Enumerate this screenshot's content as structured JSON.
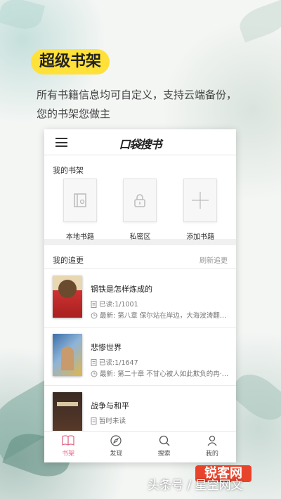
{
  "promo": {
    "title": "超级书架",
    "subtitle_line1": "所有书籍信息均可自定义，支持云端备份，",
    "subtitle_line2": "您的书架您做主"
  },
  "app": {
    "logo_text": "口袋搜书",
    "shelf_section_title": "我的书架",
    "shelf_items": [
      {
        "label": "本地书籍",
        "icon": "local-book-icon"
      },
      {
        "label": "私密区",
        "icon": "lock-icon"
      },
      {
        "label": "添加书籍",
        "icon": "plus-icon"
      }
    ],
    "following_section_title": "我的追更",
    "refresh_label": "刷新追更",
    "books": [
      {
        "title": "钢铁是怎样炼成的",
        "read": "已读:1/1001",
        "latest": "最新: 第八章  保尔站在岸边，大海波涛翻滚..."
      },
      {
        "title": "悲惨世界",
        "read": "已读:1/1647",
        "latest": "最新: 第二十章  不甘心被人如此欺负的冉·阿让..."
      },
      {
        "title": "战争与和平",
        "read": "暂时未读",
        "latest": ""
      }
    ],
    "tabs": [
      {
        "label": "书架",
        "icon": "book-icon",
        "active": true
      },
      {
        "label": "发现",
        "icon": "compass-icon",
        "active": false
      },
      {
        "label": "搜索",
        "icon": "search-icon",
        "active": false
      },
      {
        "label": "我的",
        "icon": "user-icon",
        "active": false
      }
    ]
  },
  "watermark": {
    "text": "头条号 / 星空网文",
    "badge": "锐客网"
  },
  "colors": {
    "accent_yellow": "#ffe13a",
    "tab_active": "#e26b8a"
  }
}
